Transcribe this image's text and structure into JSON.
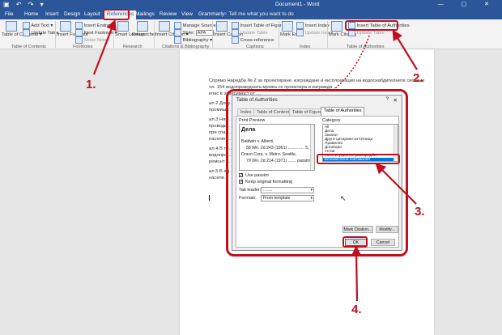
{
  "titlebar": {
    "quick_access": "▣ ↶ ↷ ▾",
    "doc_title": "Document1 - Word",
    "window_controls": "—  ▢  ✕"
  },
  "tabs": [
    "File",
    "Home",
    "Insert",
    "Design",
    "Layout",
    "References",
    "Mailings",
    "Review",
    "View",
    "Grammarly"
  ],
  "tell_me": "♀ Tell me what you want to do",
  "ribbon": {
    "toc": {
      "big": "Table of Contents ▾",
      "add_text": "Add Text ▾",
      "update_table": "Update Table",
      "group": "Table of Contents"
    },
    "footnotes": {
      "big": "Insert Footnote",
      "insert_endnote": "Insert Endnote",
      "next_footnote": "Next Footnote ▾",
      "show_notes": "Show Notes",
      "group": "Footnotes"
    },
    "research": {
      "smart_lookup": "Smart Lookup",
      "researcher": "Researcher",
      "group": "Research"
    },
    "citations": {
      "big": "Insert Citation ▾",
      "manage_sources": "Manage Sources",
      "style_label": "Style:",
      "style_value": "APA",
      "bibliography": "Bibliography ▾",
      "group": "Citations & Bibliography"
    },
    "captions": {
      "big": "Insert Caption",
      "insert_tof": "Insert Table of Figures",
      "update_table": "Update Table",
      "cross_reference": "Cross-reference",
      "group": "Captions"
    },
    "index": {
      "big": "Mark Entry",
      "insert_index": "Insert Index",
      "update_index": "Update Index",
      "group": "Index"
    },
    "authorities": {
      "big": "Mark Citation",
      "insert_toa": "Insert Table of Authorities",
      "update_table": "Update Table",
      "group": "Table of Authorities"
    }
  },
  "document": {
    "lines": [
      "Спрямо Наредба № 2 за проектиране, изграждане и експлоатация на водоснабдителните системи",
      "чл. 154 водопроводната мрежа се проектира и изгражда …",
      "клас в зависимост от …",
      "ал.2 Допу…",
      "промиш…",
      "ал.3 Няй…",
      "проводи …",
      "при спаз…",
      "населен…",
      "ал.4 В тр…",
      "водопро…",
      "ремонт …",
      "ал.5 В ад…",
      "населе…"
    ]
  },
  "dialog": {
    "title": "Table of Authorities",
    "help": "?",
    "close": "✕",
    "tabs": [
      "Index",
      "Table of Contents",
      "Table of Figures",
      "Table of Authorities"
    ],
    "print_preview_label": "Print Preview",
    "preview_heading": "Дела",
    "preview_lines": [
      "Baldwin v. Alberti,",
      "58 Wn. 2d 243 (1961) .............. 5, 6",
      "Dravo Corp. v. Metro. Seattle,",
      "79 Wn. 2d 214 (1971) ....... passim"
    ],
    "category_label": "Category",
    "categories": [
      "All",
      "Дела",
      "Закони",
      "Други цитирани източници",
      "Правилни",
      "Договори",
      "Устав",
      "Конституционни разпоредби",
      "Безсмислени изисквания"
    ],
    "selected_category": "Безсмислени изисквания",
    "use_passim_label": "Use passim",
    "keep_formatting_label": "Keep original formatting",
    "tab_leader_label": "Tab leader:",
    "tab_leader_value": "........",
    "formats_label": "Formats:",
    "formats_value": "From template",
    "mark_citation_btn": "Mark Citation...",
    "modify_btn": "Modify...",
    "ok_btn": "OK",
    "cancel_btn": "Cancel"
  },
  "annotations": {
    "step1": "1.",
    "step2": "2.",
    "step3": "3.",
    "step4": "4.",
    "accent_color": "#c0101f"
  }
}
